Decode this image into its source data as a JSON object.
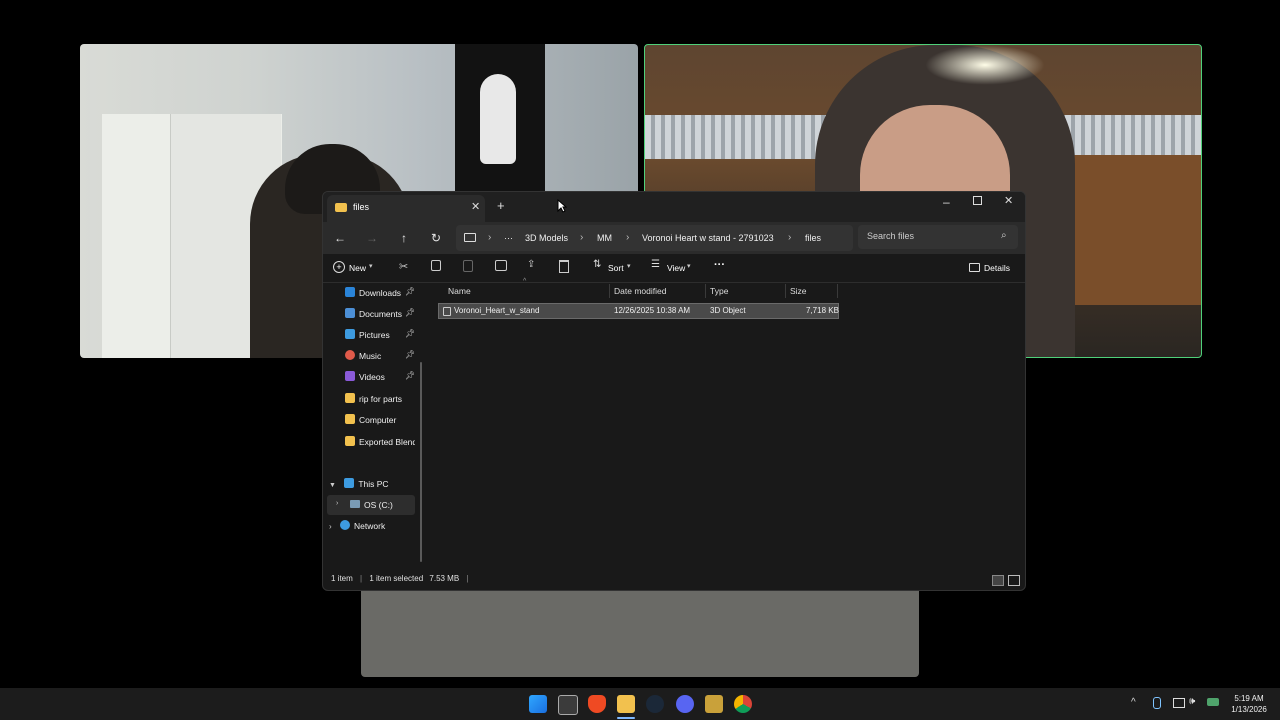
{
  "window": {
    "tab_title": "files",
    "breadcrumb": [
      "3D Models",
      "MM",
      "Voronoi Heart w stand - 2791023",
      "files"
    ],
    "ellipsis": "···",
    "search_placeholder": "Search files"
  },
  "toolbar": {
    "new_label": "New",
    "sort_label": "Sort",
    "view_label": "View",
    "more_label": "···",
    "details_label": "Details"
  },
  "sidebar": {
    "pinned": [
      {
        "label": "Downloads",
        "icon": "download-icon",
        "color": "#2a84d8"
      },
      {
        "label": "Documents",
        "icon": "document-icon",
        "color": "#4c8fd6"
      },
      {
        "label": "Pictures",
        "icon": "picture-icon",
        "color": "#3d9be0"
      },
      {
        "label": "Music",
        "icon": "music-icon",
        "color": "#e05a4a"
      },
      {
        "label": "Videos",
        "icon": "video-icon",
        "color": "#8a5ad8"
      }
    ],
    "folders": [
      {
        "label": "rip for parts",
        "icon": "folder-icon",
        "color": "#f2c14e"
      },
      {
        "label": "Computer",
        "icon": "folder-icon",
        "color": "#f2c14e"
      },
      {
        "label": "Exported Blend (",
        "icon": "folder-icon",
        "color": "#f2c14e"
      }
    ],
    "this_pc": "This PC",
    "drive": "OS (C:)",
    "network": "Network"
  },
  "columns": [
    "Name",
    "Date modified",
    "Type",
    "Size"
  ],
  "files": [
    {
      "name": "Voronoi_Heart_w_stand",
      "date": "12/26/2025 10:38 AM",
      "type": "3D Object",
      "size": "7,718 KB"
    }
  ],
  "status": {
    "count": "1 item",
    "selected": "1 item selected",
    "size": "7.53 MB"
  },
  "taskbar": {
    "time": "5:19 AM",
    "date": "1/13/2026",
    "apps": [
      "windows-start-icon",
      "snipping-tool-icon",
      "brave-icon",
      "file-explorer-icon",
      "steam-icon",
      "discord-icon",
      "world-of-warcraft-icon",
      "chrome-icon"
    ]
  },
  "colors": {
    "accent": "#4fd17a",
    "window_bg": "#191919"
  }
}
